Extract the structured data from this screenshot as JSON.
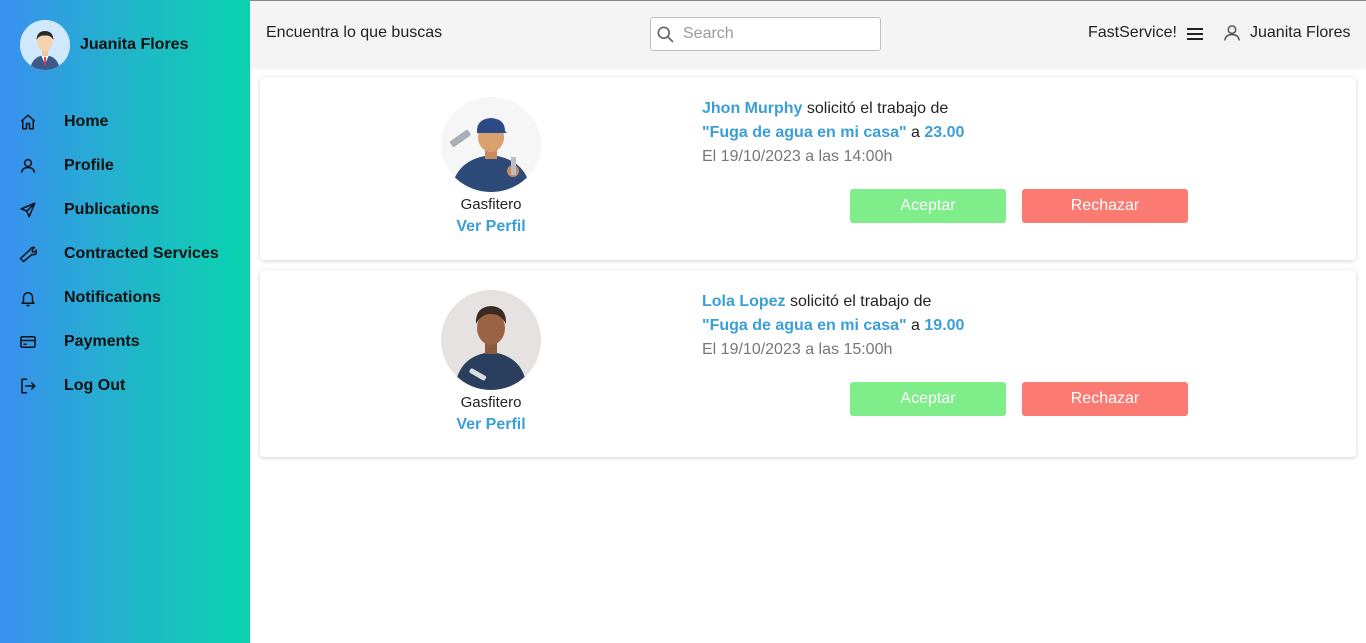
{
  "sidebar": {
    "user_name": "Juanita Flores",
    "items": [
      {
        "label": "Home",
        "icon": "home-icon"
      },
      {
        "label": "Profile",
        "icon": "user-icon"
      },
      {
        "label": "Publications",
        "icon": "send-icon"
      },
      {
        "label": "Contracted Services",
        "icon": "wrench-icon"
      },
      {
        "label": "Notifications",
        "icon": "bell-icon"
      },
      {
        "label": "Payments",
        "icon": "credit-card-icon"
      },
      {
        "label": "Log Out",
        "icon": "logout-icon"
      }
    ],
    "gradient": [
      "#3a8ff0",
      "#0ad4ae"
    ]
  },
  "header": {
    "tagline": "Encuentra lo que buscas",
    "search_placeholder": "Search",
    "brand": "FastService!",
    "user_name": "Juanita Flores"
  },
  "requests": [
    {
      "client": "Jhon Murphy",
      "text": "solicitó el trabajo de",
      "job": "\"Fuga de agua en mi casa\"",
      "connector": "a",
      "price": "23.00",
      "date": "El 19/10/2023 a las 14:00h",
      "provider_role": "Gasfitero",
      "profile_link": "Ver Perfil",
      "accept_label": "Aceptar",
      "reject_label": "Rechazar"
    },
    {
      "client": "Lola Lopez",
      "text": "solicitó el trabajo de",
      "job": "\"Fuga de agua en mi casa\"",
      "connector": "a",
      "price": "19.00",
      "date": "El 19/10/2023 a las 15:00h",
      "provider_role": "Gasfitero",
      "profile_link": "Ver Perfil",
      "accept_label": "Aceptar",
      "reject_label": "Rechazar"
    }
  ],
  "colors": {
    "accent": "#3a9fd6",
    "accept": "#7eed8a",
    "reject": "#fb7b73"
  }
}
